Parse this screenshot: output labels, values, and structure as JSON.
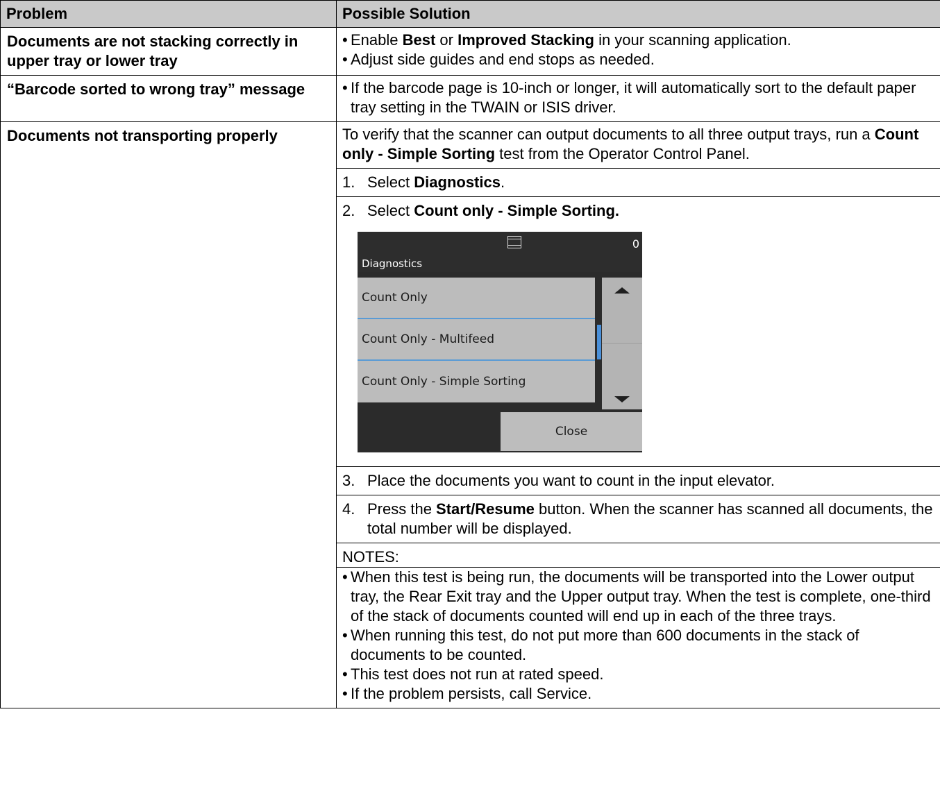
{
  "table": {
    "header": {
      "problem": "Problem",
      "solution": "Possible Solution"
    },
    "row1": {
      "problem": "Documents are not stacking correctly in upper tray or lower tray",
      "b1_pre": "Enable ",
      "b1_best": "Best",
      "b1_or": " or ",
      "b1_improved": "Improved Stacking",
      "b1_post": " in your scanning application.",
      "b2": "Adjust side guides and end stops as needed."
    },
    "row2": {
      "problem": "“Barcode sorted to wrong tray” message",
      "b1": "If the barcode page is 10-inch or longer, it will automatically sort to the default paper tray setting in the TWAIN or ISIS driver."
    },
    "row3": {
      "problem": "Documents not transporting properly",
      "intro_pre": "To verify that the scanner can output documents to all three output trays, run a ",
      "intro_bold": "Count only - Simple Sorting",
      "intro_post": " test from the Operator Control Panel.",
      "step1_num": "1.",
      "step1_pre": "Select ",
      "step1_bold": "Diagnostics",
      "step1_post": ".",
      "step2_num": "2.",
      "step2_pre": "Select ",
      "step2_bold": "Count only - Simple Sorting.",
      "step3_num": "3.",
      "step3": "Place the documents you want to count in the input elevator.",
      "step4_num": "4.",
      "step4_pre": "Press the ",
      "step4_bold": "Start/Resume",
      "step4_post": " button. When the scanner has scanned all documents, the total number will be displayed.",
      "notes_label": "NOTES:",
      "notes": [
        "When this test is being run, the documents will be transported into the Lower output tray, the Rear Exit tray and the Upper output tray. When the test is complete, one-third of the stack of documents counted will end up in each of the three trays.",
        "When running this test, do not put more than 600 documents in the stack of documents to be counted.",
        "This test does not run at rated speed.",
        "If the problem persists, call Service."
      ]
    }
  },
  "panel": {
    "title": "Diagnostics",
    "count": "0",
    "items": [
      "Count Only",
      "Count Only - Multifeed",
      "Count Only - Simple Sorting"
    ],
    "close": "Close"
  }
}
